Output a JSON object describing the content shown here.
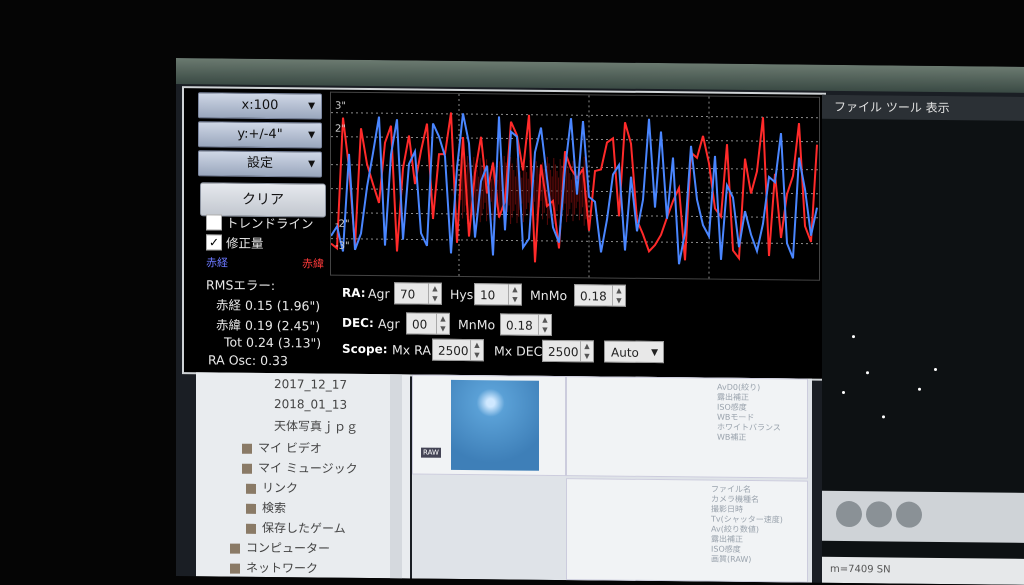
{
  "controls": {
    "x_scale": "x:100",
    "y_scale": "y:+/-4\"",
    "settings": "設定",
    "clear": "クリア",
    "trendline_label": "トレンドライン",
    "correction_label": "修正量",
    "correction_checked": "✓",
    "legend_ra": "赤経",
    "legend_dec": "赤緯"
  },
  "rms": {
    "title": "RMSエラー:",
    "ra": "赤経 0.15 (1.96\")",
    "dec": "赤緯 0.19 (2.45\")",
    "tot": "Tot 0.24 (3.13\")",
    "osc": "RA Osc: 0.33"
  },
  "graph": {
    "ticks": [
      "3\"",
      "2\"",
      "-2\"",
      "-3\""
    ],
    "colors": {
      "ra": "#4a86ff",
      "dec": "#ff2a2a"
    }
  },
  "params": {
    "ra_label": "RA:",
    "agr_label": "Agr",
    "ra_agr": "70",
    "hys_label": "Hys",
    "hys": "10",
    "mnmo_label": "MnMo",
    "ra_mnmo": "0.18",
    "dec_label": "DEC:",
    "dec_agr": "00",
    "dec_mnmo": "0.18",
    "scope_label": "Scope:",
    "mxra_label": "Mx RA",
    "mx_ra": "2500",
    "mxdec_label": "Mx DEC",
    "mx_dec": "2500",
    "mode": "Auto"
  },
  "tree": {
    "items": [
      "2017_12_17",
      "2018_01_13",
      "天体写真ｊｐｇ",
      "マイ ビデオ",
      "マイ ミュージック",
      "リンク",
      "検索",
      "保存したゲーム",
      "コンピューター",
      "ネットワーク"
    ]
  },
  "thumb": {
    "badge": "RAW"
  },
  "meta1": [
    "AvD0(絞り)",
    "露出補正",
    "ISO感度",
    "WBモード",
    "ホワイトバランス",
    "WB補正"
  ],
  "meta2": [
    "ファイル名",
    "カメラ機種名",
    "撮影日時",
    "Tv(シャッター速度)",
    "Av(絞り数値)",
    "露出補正",
    "ISO感度",
    "画質(RAW)"
  ],
  "right": {
    "menu": "ファイル  ツール  表示",
    "status": "m=7409 SN"
  }
}
